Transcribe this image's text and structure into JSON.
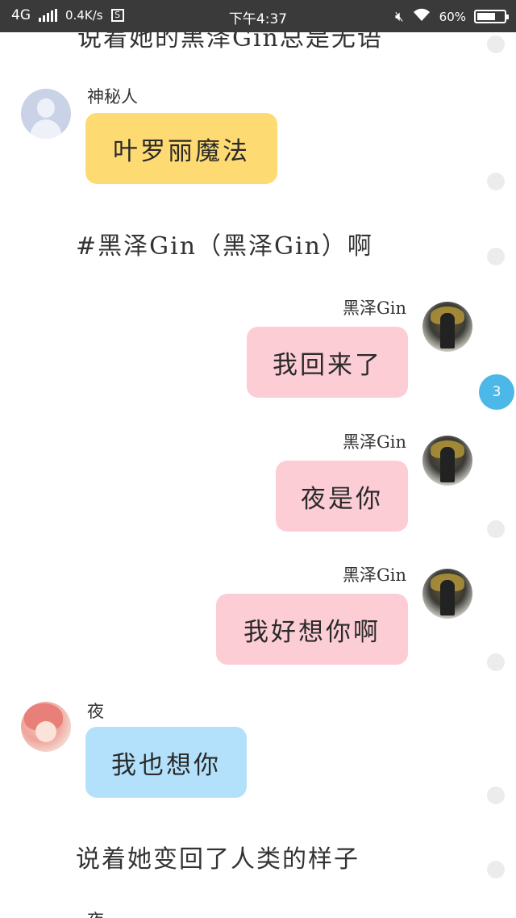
{
  "status_bar": {
    "network": "4G",
    "speed": "0.4K/s",
    "time": "下午4:37",
    "battery": "60%",
    "battery_level": 0.6,
    "icons": [
      "signal-icon",
      "screenshot-icon",
      "mute-icon",
      "wifi-icon",
      "battery-icon"
    ]
  },
  "chat": {
    "cut_off_text": "说着她的黑泽Gin总是无语",
    "messages": [
      {
        "side": "left",
        "sender": "神秘人",
        "avatar": "default-avatar-icon",
        "text": "叶罗丽魔法",
        "bubble_color": "#fedb72"
      },
      {
        "side": "center",
        "text": "#黑泽Gin（黑泽Gin）啊"
      },
      {
        "side": "right",
        "sender": "黑泽Gin",
        "avatar": "gin-avatar",
        "text": "我回来了",
        "bubble_color": "#fdcdd6"
      },
      {
        "side": "right",
        "sender": "黑泽Gin",
        "avatar": "gin-avatar",
        "text": "夜是你",
        "bubble_color": "#fdcdd6"
      },
      {
        "side": "right",
        "sender": "黑泽Gin",
        "avatar": "gin-avatar",
        "text": "我好想你啊",
        "bubble_color": "#fdcdd6"
      },
      {
        "side": "left",
        "sender": "夜",
        "avatar": "ye-avatar",
        "text": "我也想你",
        "bubble_color": "#b3e1fb"
      },
      {
        "side": "center",
        "text": "说着她变回了人类的样子"
      }
    ],
    "peek_sender": "夜",
    "unread_badge": "3"
  },
  "colors": {
    "status_bar": "#3a3a3a",
    "badge": "#4cb8e8"
  }
}
